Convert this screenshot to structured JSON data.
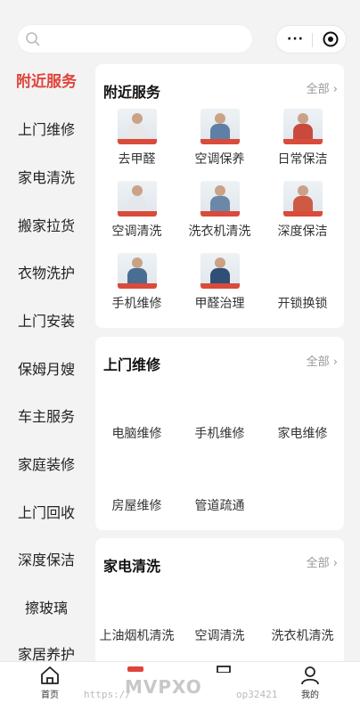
{
  "header": {
    "search_placeholder": "",
    "more_icon": "···"
  },
  "sidebar": {
    "items": [
      {
        "label": "附近服务",
        "active": true
      },
      {
        "label": "上门维修"
      },
      {
        "label": "家电清洗"
      },
      {
        "label": "搬家拉货"
      },
      {
        "label": "衣物洗护"
      },
      {
        "label": "上门安装"
      },
      {
        "label": "保姆月嫂"
      },
      {
        "label": "车主服务"
      },
      {
        "label": "家庭装修"
      },
      {
        "label": "上门回收"
      },
      {
        "label": "深度保洁"
      },
      {
        "label": "擦玻璃"
      },
      {
        "label": "家居养护"
      }
    ]
  },
  "sections": [
    {
      "title": "附近服务",
      "all_label": "全部 ›",
      "items": [
        "去甲醛",
        "空调保养",
        "日常保洁",
        "空调清洗",
        "洗衣机清洗",
        "深度保洁",
        "手机维修",
        "甲醛治理",
        "开锁换锁"
      ]
    },
    {
      "title": "上门维修",
      "all_label": "全部 ›",
      "items": [
        "电脑维修",
        "手机维修",
        "家电维修",
        "房屋维修",
        "管道疏通"
      ]
    },
    {
      "title": "家电清洗",
      "all_label": "全部 ›",
      "items": [
        "上油烟机清洗",
        "空调清洗",
        "洗衣机清洗"
      ]
    }
  ],
  "tabbar": {
    "items": [
      {
        "label": "首页",
        "icon": "home-icon"
      },
      {
        "label": "",
        "icon": "category-icon"
      },
      {
        "label": "",
        "icon": "order-icon"
      },
      {
        "label": "我的",
        "icon": "user-icon"
      }
    ]
  },
  "watermark": {
    "brand": "MVPXO",
    "url": "https://",
    "id": "op32421"
  }
}
